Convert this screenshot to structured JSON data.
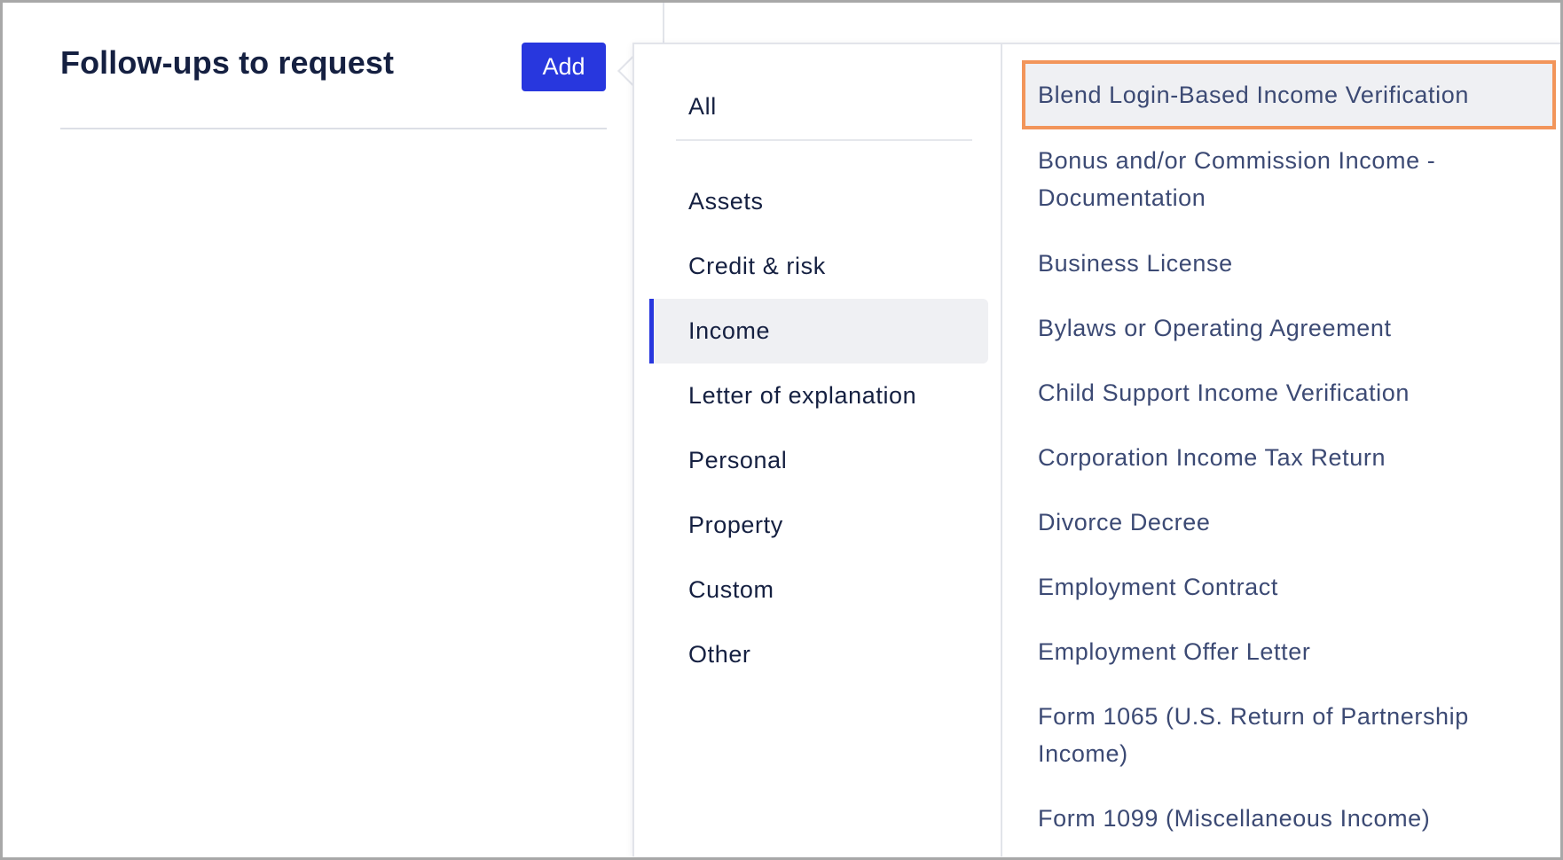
{
  "panel": {
    "title": "Follow-ups to request",
    "add_label": "Add"
  },
  "categories": [
    {
      "label": "All"
    },
    {
      "label": "Assets"
    },
    {
      "label": "Credit & risk"
    },
    {
      "label": "Income",
      "selected": true
    },
    {
      "label": "Letter of explanation"
    },
    {
      "label": "Personal"
    },
    {
      "label": "Property"
    },
    {
      "label": "Custom"
    },
    {
      "label": "Other"
    }
  ],
  "documents": [
    {
      "label": "Blend Login-Based Income Verification",
      "highlighted": true
    },
    {
      "label": "Bonus and/or Commission Income - Documentation"
    },
    {
      "label": "Business License"
    },
    {
      "label": "Bylaws or Operating Agreement"
    },
    {
      "label": "Child Support Income Verification"
    },
    {
      "label": "Corporation Income Tax Return"
    },
    {
      "label": "Divorce Decree"
    },
    {
      "label": "Employment Contract"
    },
    {
      "label": "Employment Offer Letter"
    },
    {
      "label": "Form 1065 (U.S. Return of Partnership Income)"
    },
    {
      "label": "Form 1099 (Miscellaneous Income)"
    }
  ],
  "colors": {
    "accent": "#2837de",
    "highlight_border": "#f2955a",
    "selected_bg": "#eff0f3",
    "text_primary": "#152041",
    "text_secondary": "#3c4a74"
  }
}
